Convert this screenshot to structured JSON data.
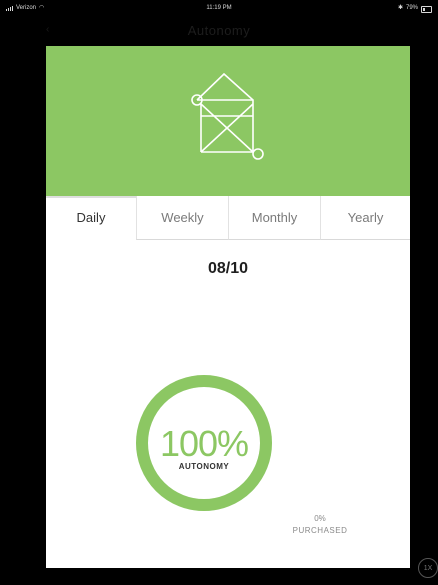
{
  "status_bar": {
    "carrier": "Verizon",
    "time": "11:19 PM",
    "battery": "79%"
  },
  "header": {
    "title": "Autonomy"
  },
  "tabs": [
    {
      "label": "Daily",
      "active": true
    },
    {
      "label": "Weekly",
      "active": false
    },
    {
      "label": "Monthly",
      "active": false
    },
    {
      "label": "Yearly",
      "active": false
    }
  ],
  "date": "08/10",
  "gauge": {
    "percent_text": "100%",
    "label": "AUTONOMY",
    "fill": 1.0
  },
  "purchased": {
    "value": "0%",
    "label": "PURCHASED"
  },
  "speed_button": "1X",
  "colors": {
    "accent": "#8cc763",
    "card": "#ffffff",
    "background": "#000000"
  },
  "icons": {
    "hero": "house-network-icon"
  }
}
